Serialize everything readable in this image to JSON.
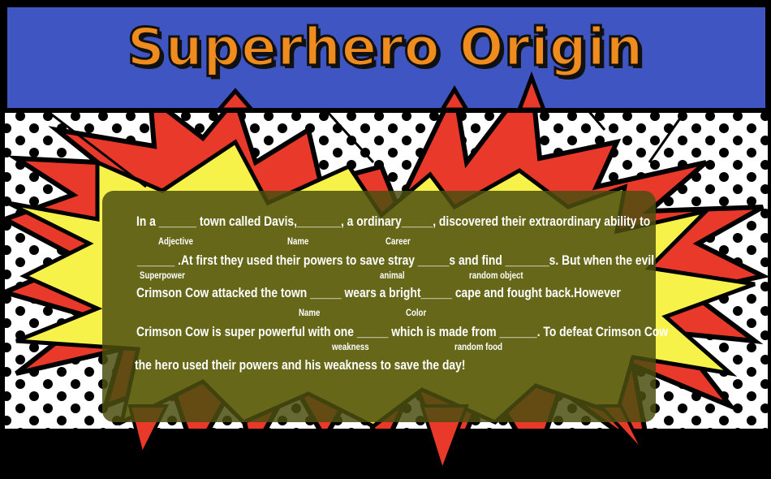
{
  "title": "Superhero Origin",
  "story": {
    "line1": "In a ______  town called Davis,_______, a ordinary_____,  discovered their extraordinary ability to",
    "line2": "______ .At first they used their powers to save stray _____s and find _______s. But when the evil",
    "line3": "Crimson Cow  attacked the town _____ wears a bright_____ cape and fought back.However",
    "line4": "Crimson Cow is super powerful with one _____ which is made from ______. To defeat Crimson Cow",
    "line5": " the hero used their powers and  his weakness to save the day!"
  },
  "hints": {
    "adjective": "Adjective",
    "name1": "Name",
    "career": "Career",
    "superpower": "Superpower",
    "animal": "animal",
    "random_object": "random object",
    "name2": "Name",
    "color": "Color",
    "weakness": "weakness",
    "random_food": "random food"
  },
  "colors": {
    "banner": "#3f55c2",
    "title_fill": "#f08c1e",
    "burst_red": "#e8392a",
    "burst_yellow": "#f7f24a",
    "text_panel": "#4c4f10",
    "ground": "#000000"
  }
}
